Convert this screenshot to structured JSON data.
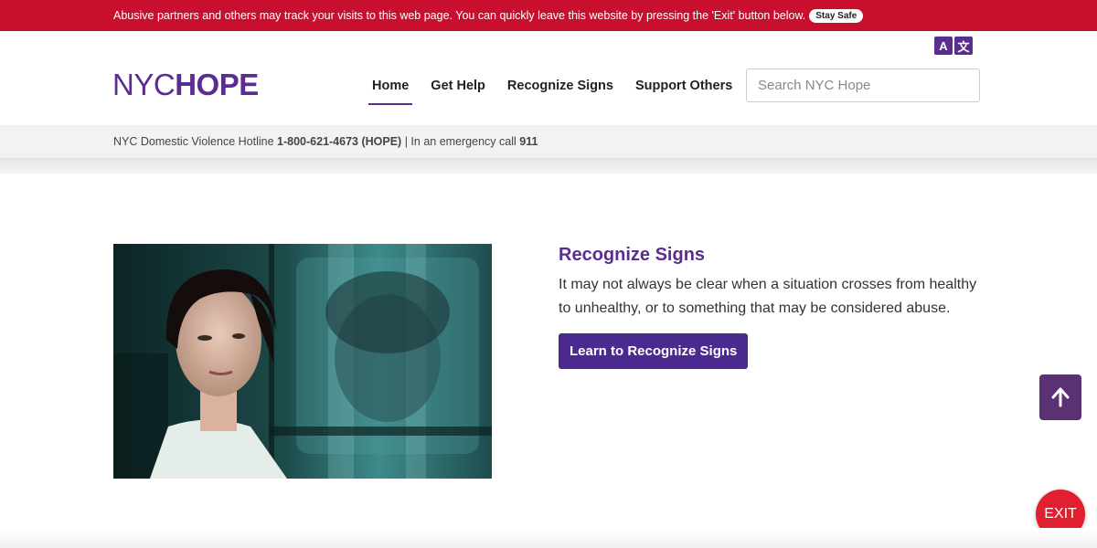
{
  "alert": {
    "message": "Abusive partners and others may track your visits to this web page. You can quickly leave this website by pressing the 'Exit' button below.",
    "stay_safe_label": "Stay Safe"
  },
  "translate": {
    "icon": "translate-icon",
    "glyph_a": "A",
    "glyph_b": "文"
  },
  "logo": {
    "part1": "NYC",
    "part2": "HOPE"
  },
  "nav": {
    "items": [
      {
        "label": "Home",
        "active": true
      },
      {
        "label": "Get Help"
      },
      {
        "label": "Recognize Signs"
      },
      {
        "label": "Support Others"
      }
    ]
  },
  "search": {
    "placeholder": "Search NYC Hope",
    "value": ""
  },
  "hotline": {
    "prefix": "NYC Domestic Violence Hotline",
    "number": "1-800-621-4673 (HOPE)",
    "separator": "| In an emergency call",
    "emergency": "911"
  },
  "feature": {
    "title": "Recognize Signs",
    "body": "It may not always be clear when a situation crosses from healthy to unhealthy, or to something that may be considered abuse.",
    "cta_label": "Learn to Recognize Signs"
  },
  "back_to_top": {
    "icon": "arrow-up-icon"
  },
  "exit": {
    "label": "EXIT"
  },
  "colors": {
    "alert_red": "#c8102e",
    "brand_purple": "#5b2d91",
    "exit_red": "#e02030"
  }
}
